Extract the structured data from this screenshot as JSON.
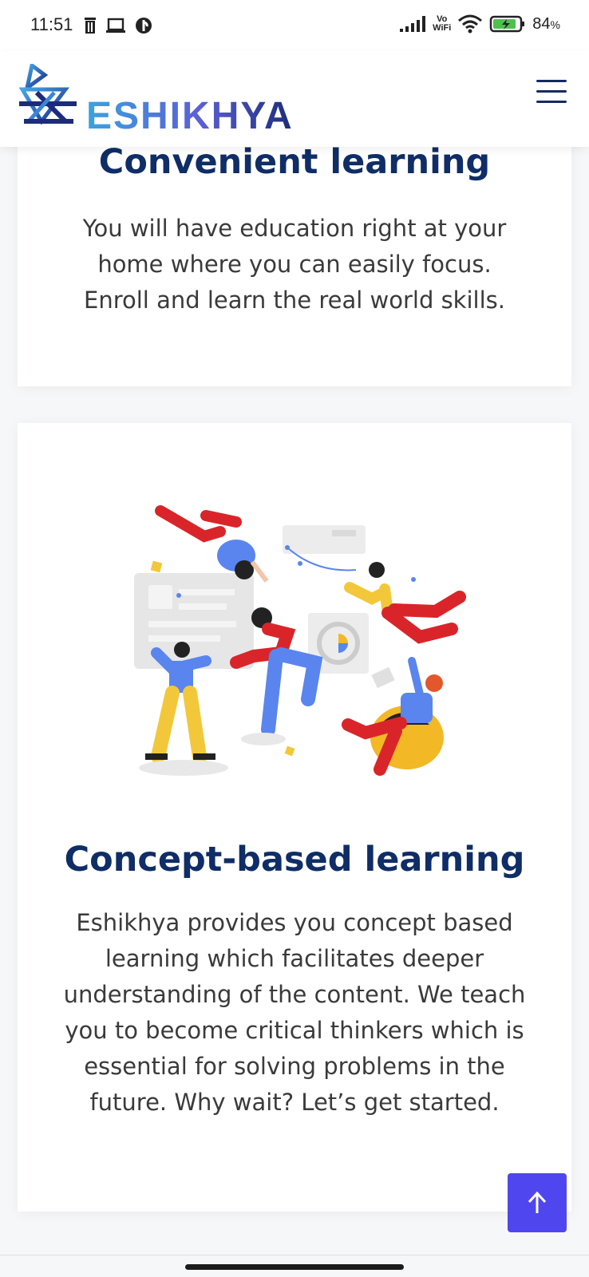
{
  "status_bar": {
    "time": "11:51",
    "battery_percent": "84",
    "battery_symbol": "%",
    "wifi_label_top": "Vo",
    "wifi_label_bottom": "WiFi",
    "icons": [
      "trash-icon",
      "laptop-icon",
      "app-icon",
      "signal-icon",
      "wifi-icon",
      "battery-icon"
    ]
  },
  "header": {
    "brand": "ESHIKHYA",
    "logo_icon": "logo-mark-icon",
    "menu_icon": "hamburger-menu-icon"
  },
  "cards": [
    {
      "title": "Convenient learning",
      "text": "You will have education right at your home where you can easily focus. Enroll and learn the real world skills."
    },
    {
      "title": "Concept-based learning",
      "text": "Eshikhya provides you concept based learning which facilitates deeper understanding of the content. We teach you to become critical thinkers which is essential for solving problems in the future. Why wait? Let’s get started."
    }
  ],
  "scroll_top_icon": "arrow-up-icon",
  "colors": {
    "title": "#0f2d66",
    "body_text": "#3a3a3a",
    "accent_button": "#4f46f0",
    "page_bg": "#f6f7f9"
  }
}
